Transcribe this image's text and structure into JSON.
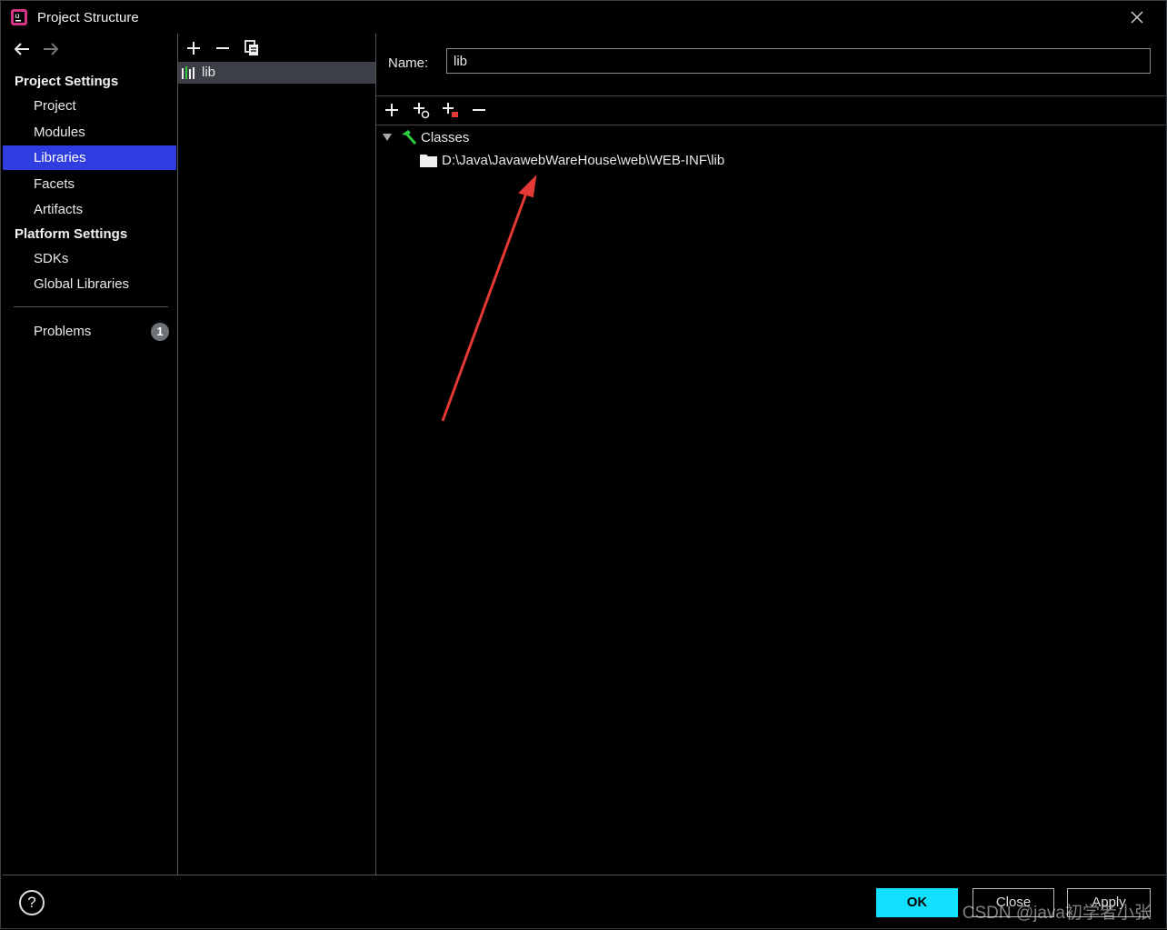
{
  "window": {
    "title": "Project Structure"
  },
  "sidebar": {
    "project_settings_label": "Project Settings",
    "project_items": [
      "Project",
      "Modules",
      "Libraries",
      "Facets",
      "Artifacts"
    ],
    "platform_settings_label": "Platform Settings",
    "platform_items": [
      "SDKs",
      "Global Libraries"
    ],
    "problems_label": "Problems",
    "problems_count": "1",
    "selected": "Libraries"
  },
  "libraries": {
    "items": [
      "lib"
    ]
  },
  "detail": {
    "name_label": "Name:",
    "name_value": "lib",
    "tree": {
      "root_label": "Classes",
      "children": [
        "D:\\Java\\JavawebWareHouse\\web\\WEB-INF\\lib"
      ]
    }
  },
  "footer": {
    "help": "?",
    "ok_label": "OK",
    "close_label": "Close",
    "apply_label": "Apply",
    "watermark": "CSDN @java初学者小张"
  },
  "colors": {
    "selection": "#2f3de0",
    "ok_button": "#12e0ff",
    "annotation_arrow": "#e53935",
    "classes_icon": "#2ecc40"
  }
}
